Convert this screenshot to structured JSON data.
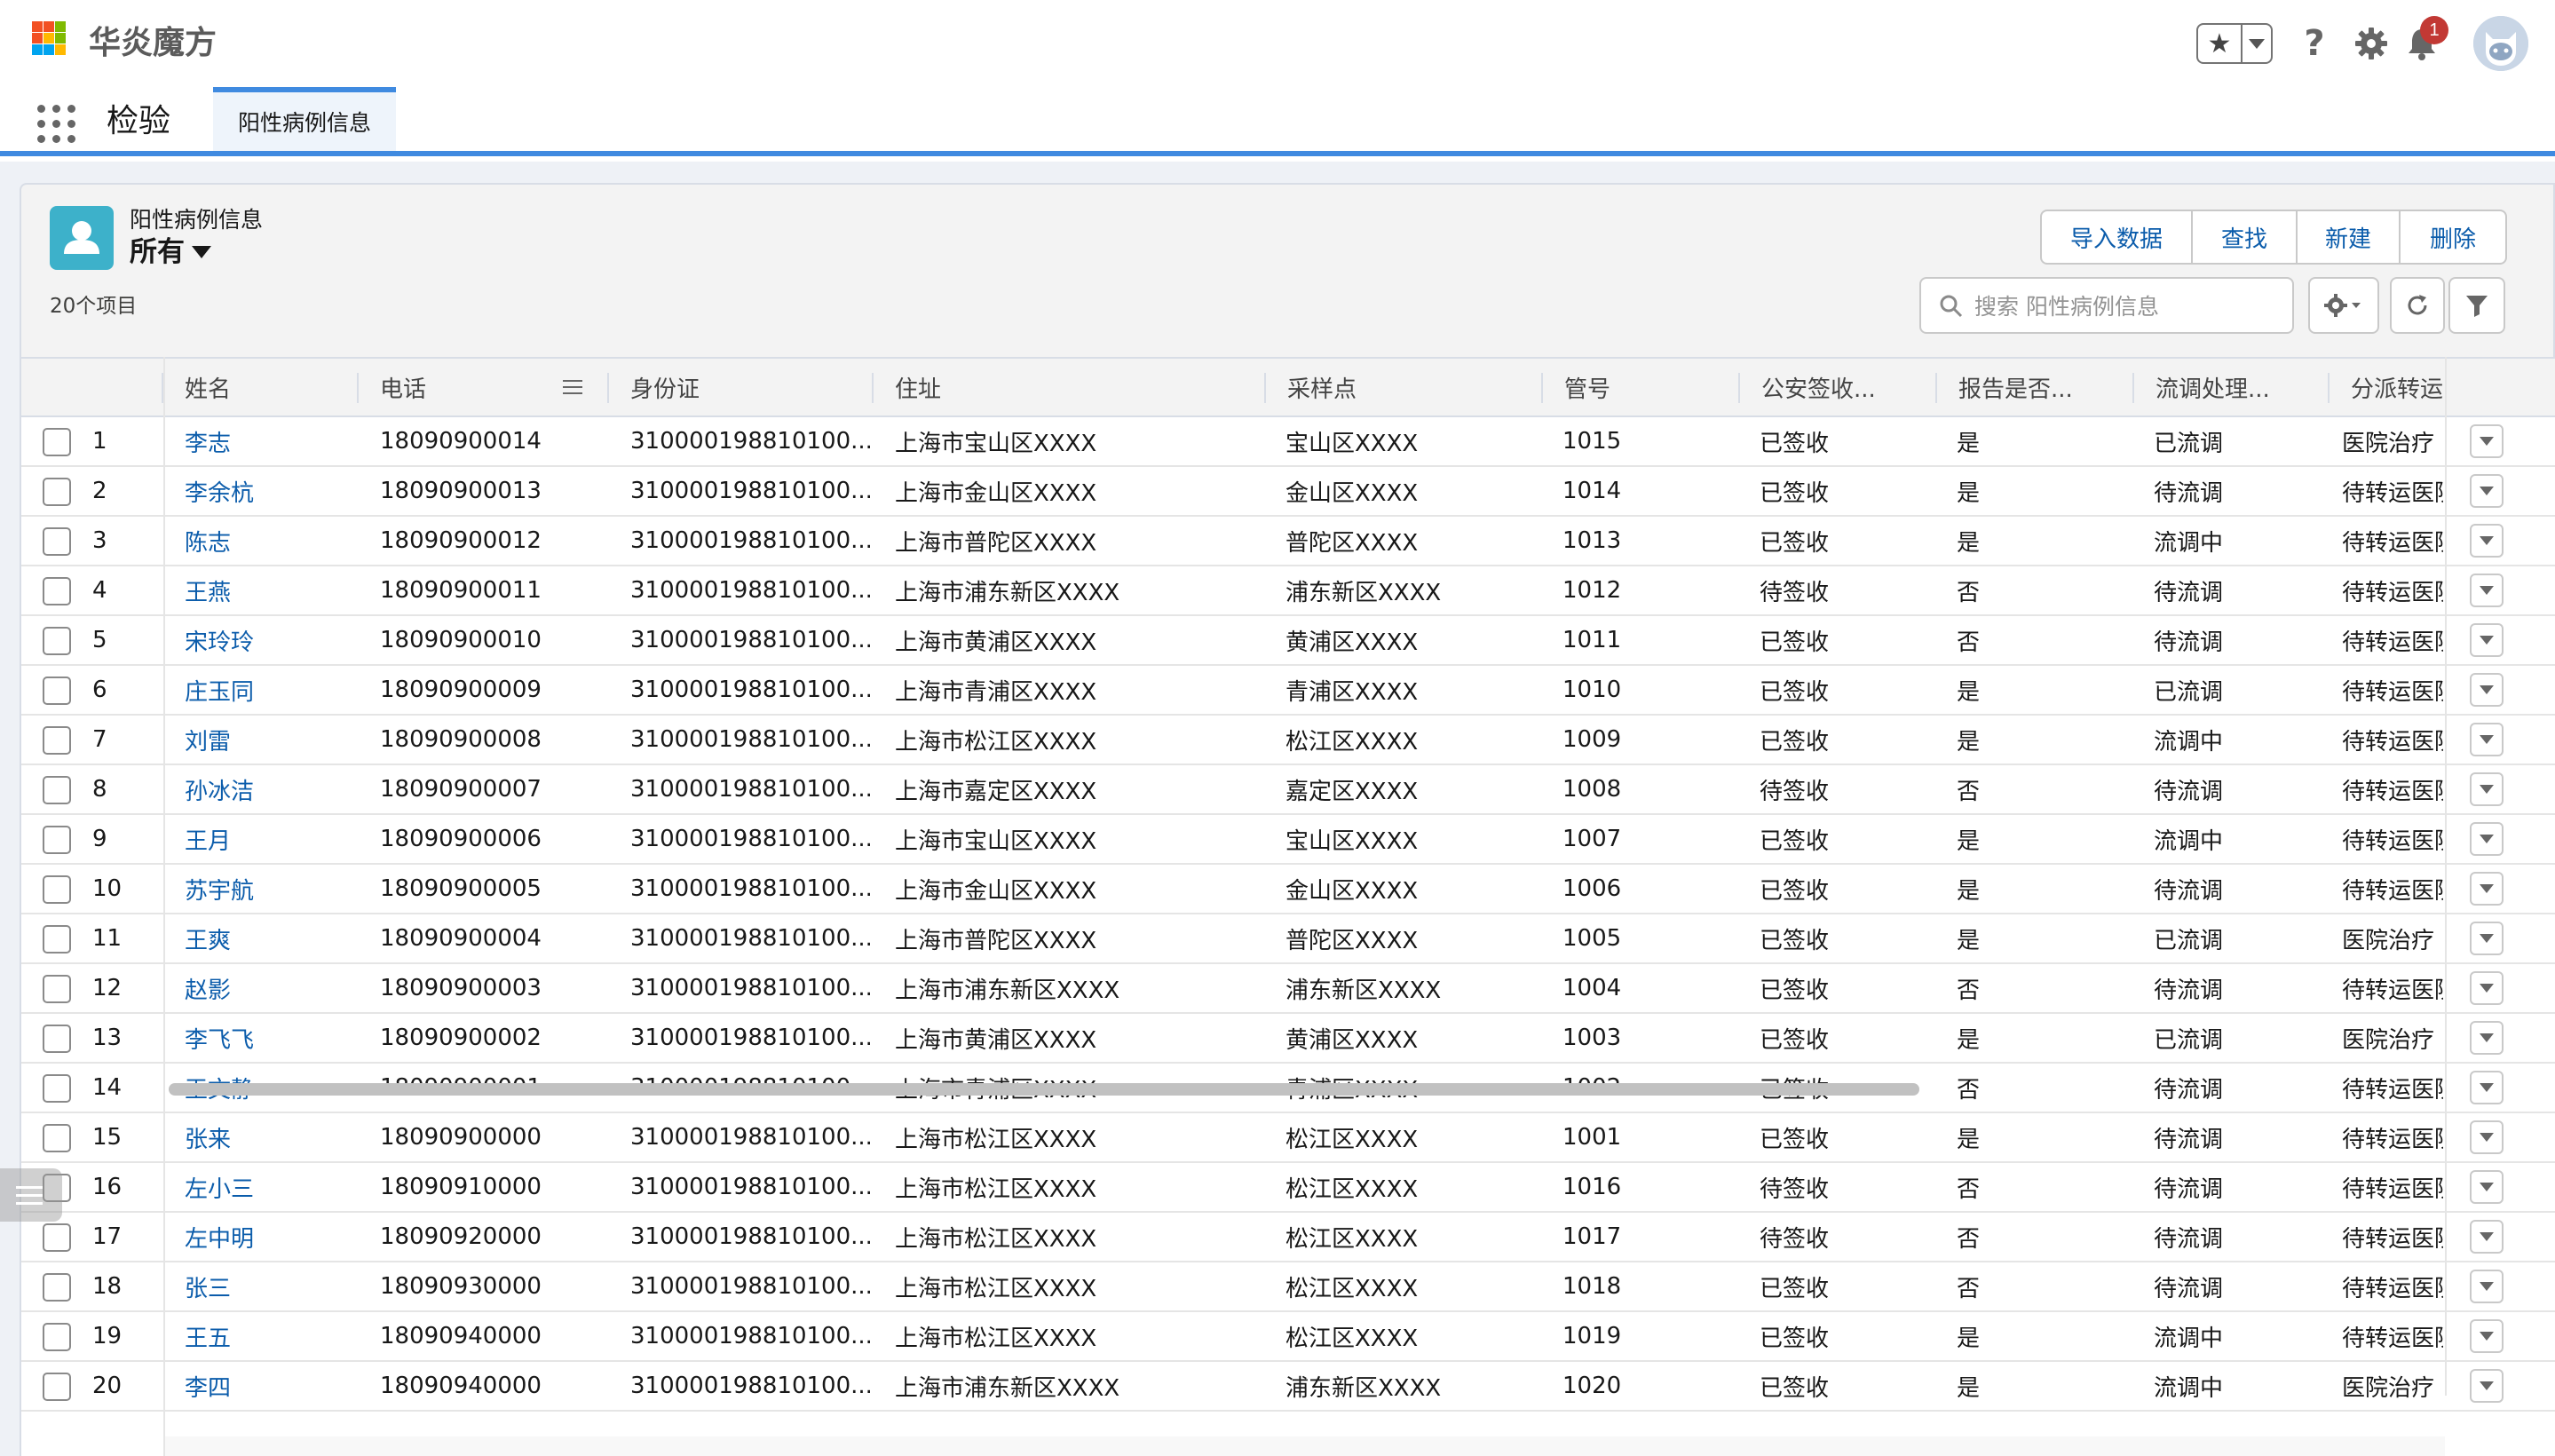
{
  "brand": {
    "name": "华炎魔方",
    "logo_colors": [
      "#f25022",
      "#7fba00",
      "#00a4ef",
      "#ffb900"
    ]
  },
  "header": {
    "notification_count": "1",
    "help_symbol": "?"
  },
  "nav": {
    "app_name": "检验",
    "tabs": [
      {
        "label": "阳性病例信息",
        "active": true
      }
    ]
  },
  "list": {
    "object_label": "阳性病例信息",
    "view_name": "所有",
    "item_count": "20个项目",
    "buttons": [
      "导入数据",
      "查找",
      "新建",
      "删除"
    ],
    "search_placeholder": "搜索 阳性病例信息"
  },
  "table": {
    "columns": [
      "姓名",
      "电话",
      "身份证",
      "住址",
      "采样点",
      "管号",
      "公安签收...",
      "报告是否...",
      "流调处理...",
      "分派转运院"
    ],
    "rows": [
      {
        "no": "1",
        "name": "李志",
        "phone": "18090900014",
        "id": "310000198810100...",
        "address": "上海市宝山区XXXX",
        "site": "宝山区XXXX",
        "tube": "1015",
        "police": "已签收",
        "report": "是",
        "flow": "已流调",
        "transfer": "医院治疗"
      },
      {
        "no": "2",
        "name": "李余杭",
        "phone": "18090900013",
        "id": "310000198810100...",
        "address": "上海市金山区XXXX",
        "site": "金山区XXXX",
        "tube": "1014",
        "police": "已签收",
        "report": "是",
        "flow": "待流调",
        "transfer": "待转运医院"
      },
      {
        "no": "3",
        "name": "陈志",
        "phone": "18090900012",
        "id": "310000198810100...",
        "address": "上海市普陀区XXXX",
        "site": "普陀区XXXX",
        "tube": "1013",
        "police": "已签收",
        "report": "是",
        "flow": "流调中",
        "transfer": "待转运医院"
      },
      {
        "no": "4",
        "name": "王燕",
        "phone": "18090900011",
        "id": "310000198810100...",
        "address": "上海市浦东新区XXXX",
        "site": "浦东新区XXXX",
        "tube": "1012",
        "police": "待签收",
        "report": "否",
        "flow": "待流调",
        "transfer": "待转运医院"
      },
      {
        "no": "5",
        "name": "宋玲玲",
        "phone": "18090900010",
        "id": "310000198810100...",
        "address": "上海市黄浦区XXXX",
        "site": "黄浦区XXXX",
        "tube": "1011",
        "police": "已签收",
        "report": "否",
        "flow": "待流调",
        "transfer": "待转运医院"
      },
      {
        "no": "6",
        "name": "庄玉同",
        "phone": "18090900009",
        "id": "310000198810100...",
        "address": "上海市青浦区XXXX",
        "site": "青浦区XXXX",
        "tube": "1010",
        "police": "已签收",
        "report": "是",
        "flow": "已流调",
        "transfer": "待转运医院"
      },
      {
        "no": "7",
        "name": "刘雷",
        "phone": "18090900008",
        "id": "310000198810100...",
        "address": "上海市松江区XXXX",
        "site": "松江区XXXX",
        "tube": "1009",
        "police": "已签收",
        "report": "是",
        "flow": "流调中",
        "transfer": "待转运医院"
      },
      {
        "no": "8",
        "name": "孙冰洁",
        "phone": "18090900007",
        "id": "310000198810100...",
        "address": "上海市嘉定区XXXX",
        "site": "嘉定区XXXX",
        "tube": "1008",
        "police": "待签收",
        "report": "否",
        "flow": "待流调",
        "transfer": "待转运医院"
      },
      {
        "no": "9",
        "name": "王月",
        "phone": "18090900006",
        "id": "310000198810100...",
        "address": "上海市宝山区XXXX",
        "site": "宝山区XXXX",
        "tube": "1007",
        "police": "已签收",
        "report": "是",
        "flow": "流调中",
        "transfer": "待转运医院"
      },
      {
        "no": "10",
        "name": "苏宇航",
        "phone": "18090900005",
        "id": "310000198810100...",
        "address": "上海市金山区XXXX",
        "site": "金山区XXXX",
        "tube": "1006",
        "police": "已签收",
        "report": "是",
        "flow": "待流调",
        "transfer": "待转运医院"
      },
      {
        "no": "11",
        "name": "王爽",
        "phone": "18090900004",
        "id": "310000198810100...",
        "address": "上海市普陀区XXXX",
        "site": "普陀区XXXX",
        "tube": "1005",
        "police": "已签收",
        "report": "是",
        "flow": "已流调",
        "transfer": "医院治疗"
      },
      {
        "no": "12",
        "name": "赵影",
        "phone": "18090900003",
        "id": "310000198810100...",
        "address": "上海市浦东新区XXXX",
        "site": "浦东新区XXXX",
        "tube": "1004",
        "police": "已签收",
        "report": "否",
        "flow": "待流调",
        "transfer": "待转运医院"
      },
      {
        "no": "13",
        "name": "李飞飞",
        "phone": "18090900002",
        "id": "310000198810100...",
        "address": "上海市黄浦区XXXX",
        "site": "黄浦区XXXX",
        "tube": "1003",
        "police": "已签收",
        "report": "是",
        "flow": "已流调",
        "transfer": "医院治疗"
      },
      {
        "no": "14",
        "name": "王文静",
        "phone": "18090900001",
        "id": "310000198810100...",
        "address": "上海市青浦区XXXX",
        "site": "青浦区XXXX",
        "tube": "1002",
        "police": "已签收",
        "report": "否",
        "flow": "待流调",
        "transfer": "待转运医院"
      },
      {
        "no": "15",
        "name": "张来",
        "phone": "18090900000",
        "id": "310000198810100...",
        "address": "上海市松江区XXXX",
        "site": "松江区XXXX",
        "tube": "1001",
        "police": "已签收",
        "report": "是",
        "flow": "待流调",
        "transfer": "待转运医院"
      },
      {
        "no": "16",
        "name": "左小三",
        "phone": "18090910000",
        "id": "310000198810100...",
        "address": "上海市松江区XXXX",
        "site": "松江区XXXX",
        "tube": "1016",
        "police": "待签收",
        "report": "否",
        "flow": "待流调",
        "transfer": "待转运医院"
      },
      {
        "no": "17",
        "name": "左中明",
        "phone": "18090920000",
        "id": "310000198810100...",
        "address": "上海市松江区XXXX",
        "site": "松江区XXXX",
        "tube": "1017",
        "police": "待签收",
        "report": "否",
        "flow": "待流调",
        "transfer": "待转运医院"
      },
      {
        "no": "18",
        "name": "张三",
        "phone": "18090930000",
        "id": "310000198810100...",
        "address": "上海市松江区XXXX",
        "site": "松江区XXXX",
        "tube": "1018",
        "police": "已签收",
        "report": "否",
        "flow": "待流调",
        "transfer": "待转运医院"
      },
      {
        "no": "19",
        "name": "王五",
        "phone": "18090940000",
        "id": "310000198810100...",
        "address": "上海市松江区XXXX",
        "site": "松江区XXXX",
        "tube": "1019",
        "police": "已签收",
        "report": "是",
        "flow": "流调中",
        "transfer": "待转运医院"
      },
      {
        "no": "20",
        "name": "李四",
        "phone": "18090940000",
        "id": "310000198810100...",
        "address": "上海市浦东新区XXXX",
        "site": "浦东新区XXXX",
        "tube": "1020",
        "police": "已签收",
        "report": "是",
        "flow": "流调中",
        "transfer": "医院治疗"
      }
    ]
  }
}
